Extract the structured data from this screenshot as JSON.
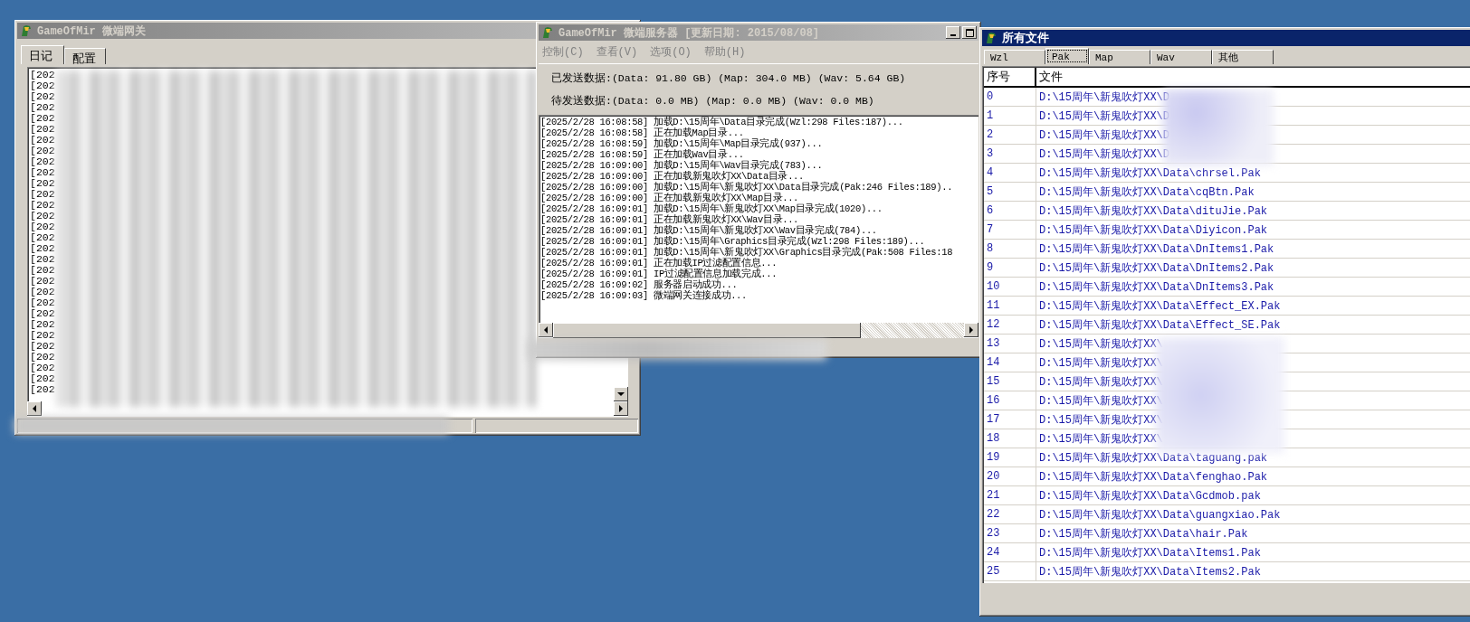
{
  "gateway_window": {
    "title": "GameOfMir 微端网关",
    "active": false,
    "tabs": [
      {
        "label": "日记",
        "selected": true
      },
      {
        "label": "配置",
        "selected": false
      }
    ],
    "log_lines": [
      "[202",
      "[202",
      "[202",
      "[202",
      "[202",
      "[202",
      "[202",
      "[202",
      "[202",
      "[202",
      "[202",
      "[202",
      "[202",
      "[202",
      "[202",
      "[202",
      "[202",
      "[202",
      "[202",
      "[202",
      "[202",
      "[202",
      "[202",
      "[202",
      "[202",
      "[202",
      "[202",
      "[202",
      "[202",
      "[202"
    ]
  },
  "server_window": {
    "title": "GameOfMir 微端服务器 [更新日期: 2015/08/08]",
    "active": false,
    "menu": [
      "控制(C)",
      "查看(V)",
      "选项(O)",
      "帮助(H)"
    ],
    "sent_stats": "已发送数据:(Data: 91.80 GB) (Map: 304.0 MB) (Wav: 5.64 GB)",
    "pending_stats": "待发送数据:(Data: 0.0 MB) (Map: 0.0 MB) (Wav: 0.0 MB)",
    "log_lines": [
      "[2025/2/28 16:08:58] 加载D:\\15周年\\Data目录完成(Wzl:298 Files:187)...",
      "[2025/2/28 16:08:58] 正在加载Map目录...",
      "[2025/2/28 16:08:59] 加载D:\\15周年\\Map目录完成(937)...",
      "[2025/2/28 16:08:59] 正在加载Wav目录...",
      "[2025/2/28 16:09:00] 加载D:\\15周年\\Wav目录完成(783)...",
      "[2025/2/28 16:09:00] 正在加载新鬼吹灯XX\\Data目录...",
      "[2025/2/28 16:09:00] 加载D:\\15周年\\新鬼吹灯XX\\Data目录完成(Pak:246 Files:189)..",
      "[2025/2/28 16:09:00] 正在加载新鬼吹灯XX\\Map目录...",
      "[2025/2/28 16:09:01] 加载D:\\15周年\\新鬼吹灯XX\\Map目录完成(1020)...",
      "[2025/2/28 16:09:01] 正在加载新鬼吹灯XX\\Wav目录...",
      "[2025/2/28 16:09:01] 加载D:\\15周年\\新鬼吹灯XX\\Wav目录完成(784)...",
      "[2025/2/28 16:09:01] 加载D:\\15周年\\Graphics目录完成(Wzl:298 Files:189)...",
      "[2025/2/28 16:09:01] 加载D:\\15周年\\新鬼吹灯XX\\Graphics目录完成(Pak:508 Files:18",
      "[2025/2/28 16:09:01] 正在加载IP过滤配置信息...",
      "[2025/2/28 16:09:01] IP过滤配置信息加载完成...",
      "[2025/2/28 16:09:02] 服务器启动成功...",
      "[2025/2/28 16:09:03] 微端网关连接成功..."
    ]
  },
  "files_window": {
    "title": "所有文件",
    "active": true,
    "tabs": [
      {
        "label": "Wzl",
        "selected": false
      },
      {
        "label": "Pak",
        "selected": true
      },
      {
        "label": "Map",
        "selected": false
      },
      {
        "label": "Wav",
        "selected": false
      },
      {
        "label": "其他",
        "selected": false
      }
    ],
    "table": {
      "columns": [
        "序号",
        "文件"
      ],
      "rows": [
        {
          "index": "0",
          "file": "D:\\15周年\\新鬼吹灯XX\\D"
        },
        {
          "index": "1",
          "file": "D:\\15周年\\新鬼吹灯XX\\D"
        },
        {
          "index": "2",
          "file": "D:\\15周年\\新鬼吹灯XX\\D"
        },
        {
          "index": "3",
          "file": "D:\\15周年\\新鬼吹灯XX\\D"
        },
        {
          "index": "4",
          "file": "D:\\15周年\\新鬼吹灯XX\\Data\\chrsel.Pak"
        },
        {
          "index": "5",
          "file": "D:\\15周年\\新鬼吹灯XX\\Data\\cqBtn.Pak"
        },
        {
          "index": "6",
          "file": "D:\\15周年\\新鬼吹灯XX\\Data\\dituJie.Pak"
        },
        {
          "index": "7",
          "file": "D:\\15周年\\新鬼吹灯XX\\Data\\Diyicon.Pak"
        },
        {
          "index": "8",
          "file": "D:\\15周年\\新鬼吹灯XX\\Data\\DnItems1.Pak"
        },
        {
          "index": "9",
          "file": "D:\\15周年\\新鬼吹灯XX\\Data\\DnItems2.Pak"
        },
        {
          "index": "10",
          "file": "D:\\15周年\\新鬼吹灯XX\\Data\\DnItems3.Pak"
        },
        {
          "index": "11",
          "file": "D:\\15周年\\新鬼吹灯XX\\Data\\Effect_EX.Pak"
        },
        {
          "index": "12",
          "file": "D:\\15周年\\新鬼吹灯XX\\Data\\Effect_SE.Pak"
        },
        {
          "index": "13",
          "file": "D:\\15周年\\新鬼吹灯XX\\"
        },
        {
          "index": "14",
          "file": "D:\\15周年\\新鬼吹灯XX\\"
        },
        {
          "index": "15",
          "file": "D:\\15周年\\新鬼吹灯XX\\"
        },
        {
          "index": "16",
          "file": "D:\\15周年\\新鬼吹灯XX\\"
        },
        {
          "index": "17",
          "file": "D:\\15周年\\新鬼吹灯XX\\"
        },
        {
          "index": "18",
          "file": "D:\\15周年\\新鬼吹灯XX\\"
        },
        {
          "index": "19",
          "file": "D:\\15周年\\新鬼吹灯XX\\Data\\taguang.pak"
        },
        {
          "index": "20",
          "file": "D:\\15周年\\新鬼吹灯XX\\Data\\fenghao.Pak"
        },
        {
          "index": "21",
          "file": "D:\\15周年\\新鬼吹灯XX\\Data\\Gcdmob.pak"
        },
        {
          "index": "22",
          "file": "D:\\15周年\\新鬼吹灯XX\\Data\\guangxiao.Pak"
        },
        {
          "index": "23",
          "file": "D:\\15周年\\新鬼吹灯XX\\Data\\hair.Pak"
        },
        {
          "index": "24",
          "file": "D:\\15周年\\新鬼吹灯XX\\Data\\Items1.Pak"
        },
        {
          "index": "25",
          "file": "D:\\15周年\\新鬼吹灯XX\\Data\\Items2.Pak"
        }
      ]
    }
  }
}
